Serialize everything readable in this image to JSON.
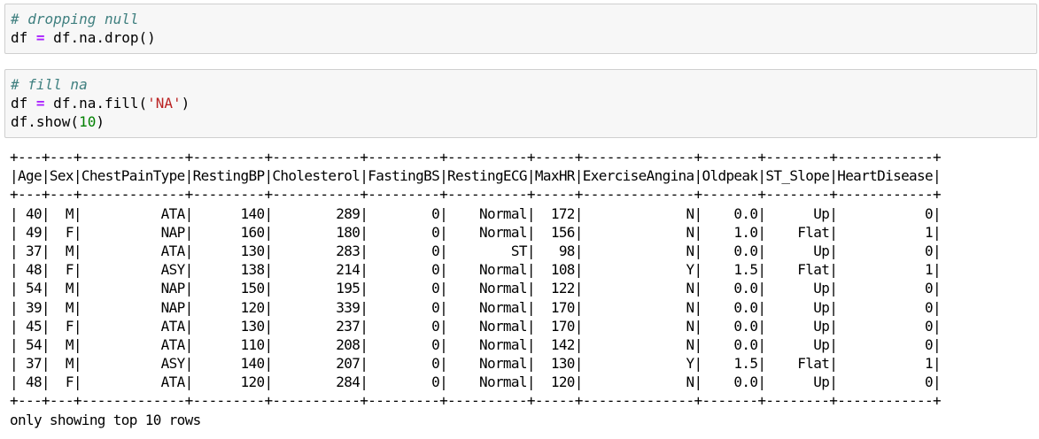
{
  "cells": [
    {
      "lines": [
        [
          {
            "t": "# dropping null",
            "c": "comment"
          }
        ],
        [
          {
            "t": "df "
          },
          {
            "t": "=",
            "c": "op"
          },
          {
            "t": " df.na.drop()"
          }
        ]
      ]
    },
    {
      "lines": [
        [
          {
            "t": "# fill na",
            "c": "comment"
          }
        ],
        [
          {
            "t": "df "
          },
          {
            "t": "=",
            "c": "op"
          },
          {
            "t": " df.na.fill("
          },
          {
            "t": "'NA'",
            "c": "str"
          },
          {
            "t": ")"
          }
        ],
        [
          {
            "t": "df.show("
          },
          {
            "t": "10",
            "c": "num"
          },
          {
            "t": ")"
          }
        ]
      ]
    }
  ],
  "output": {
    "separator": "+---+---+-------------+---------+-----------+---------+----------+-----+--------------+-------+--------+------------+",
    "header": "|Age|Sex|ChestPainType|RestingBP|Cholesterol|FastingBS|RestingECG|MaxHR|ExerciseAngina|Oldpeak|ST_Slope|HeartDisease|",
    "rows": [
      "| 40|  M|          ATA|      140|        289|        0|    Normal|  172|             N|    0.0|      Up|           0|",
      "| 49|  F|          NAP|      160|        180|        0|    Normal|  156|             N|    1.0|    Flat|           1|",
      "| 37|  M|          ATA|      130|        283|        0|        ST|   98|             N|    0.0|      Up|           0|",
      "| 48|  F|          ASY|      138|        214|        0|    Normal|  108|             Y|    1.5|    Flat|           1|",
      "| 54|  M|          NAP|      150|        195|        0|    Normal|  122|             N|    0.0|      Up|           0|",
      "| 39|  M|          NAP|      120|        339|        0|    Normal|  170|             N|    0.0|      Up|           0|",
      "| 45|  F|          ATA|      130|        237|        0|    Normal|  170|             N|    0.0|      Up|           0|",
      "| 54|  M|          ATA|      110|        208|        0|    Normal|  142|             N|    0.0|      Up|           0|",
      "| 37|  M|          ASY|      140|        207|        0|    Normal|  130|             Y|    1.5|    Flat|           1|",
      "| 48|  F|          ATA|      120|        284|        0|    Normal|  120|             N|    0.0|      Up|           0|"
    ],
    "footer": "only showing top 10 rows"
  },
  "colors": {
    "cell_bg": "#f7f7f7",
    "cell_border": "#cfcfcf",
    "comment": "#408080",
    "operator": "#aa22ff",
    "string": "#ba2121",
    "number": "#008000"
  }
}
